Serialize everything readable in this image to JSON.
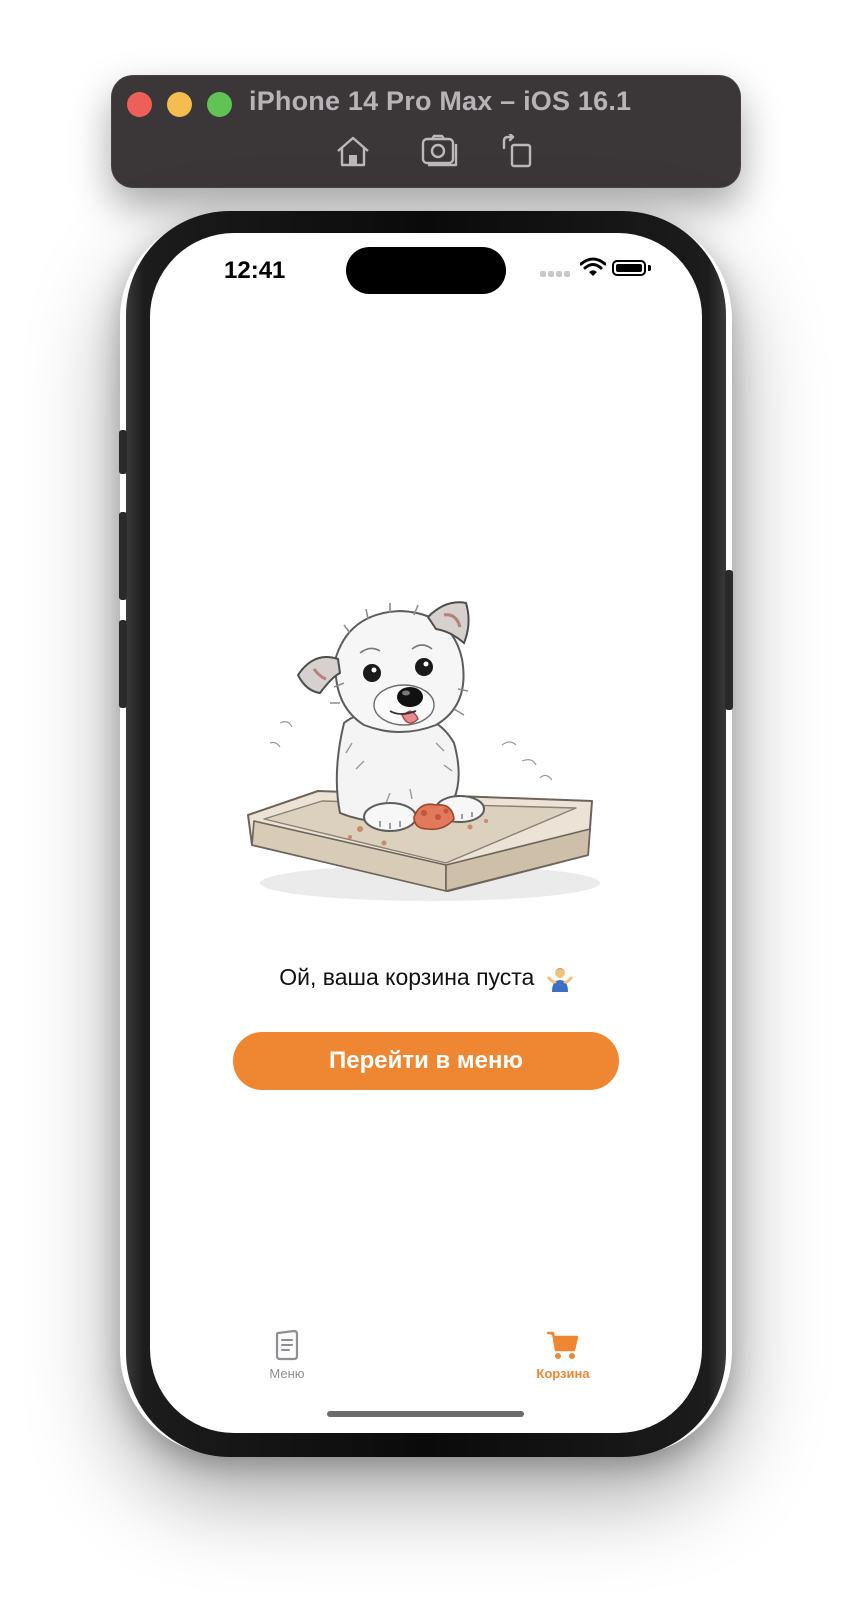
{
  "simulator": {
    "title": "iPhone 14 Pro Max – iOS 16.1",
    "buttons": [
      "home-icon",
      "screenshot-icon",
      "rotate-icon"
    ]
  },
  "status_bar": {
    "time": "12:41"
  },
  "cart": {
    "empty_message": "Ой, ваша корзина пуста",
    "empty_emoji": "person-shrugging",
    "menu_button_label": "Перейти в меню",
    "accent_color": "#ef8632"
  },
  "tab_bar": {
    "tabs": [
      {
        "label": "Меню",
        "icon": "menu-book-icon",
        "selected": false
      },
      {
        "label": "Корзина",
        "icon": "cart-icon",
        "selected": true
      }
    ]
  }
}
